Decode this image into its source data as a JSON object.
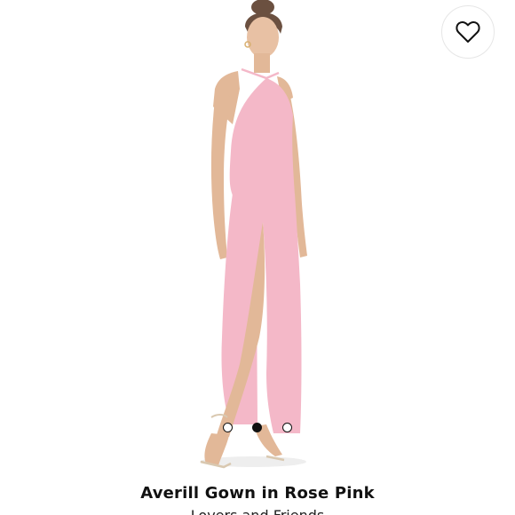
{
  "product": {
    "title": "Averill Gown in Rose Pink",
    "brand": "Lovers and Friends",
    "dress_color": "#f4b8c8"
  },
  "favorite": {
    "icon": "heart-icon"
  },
  "carousel": {
    "total_images": 3,
    "active_index": 1
  }
}
